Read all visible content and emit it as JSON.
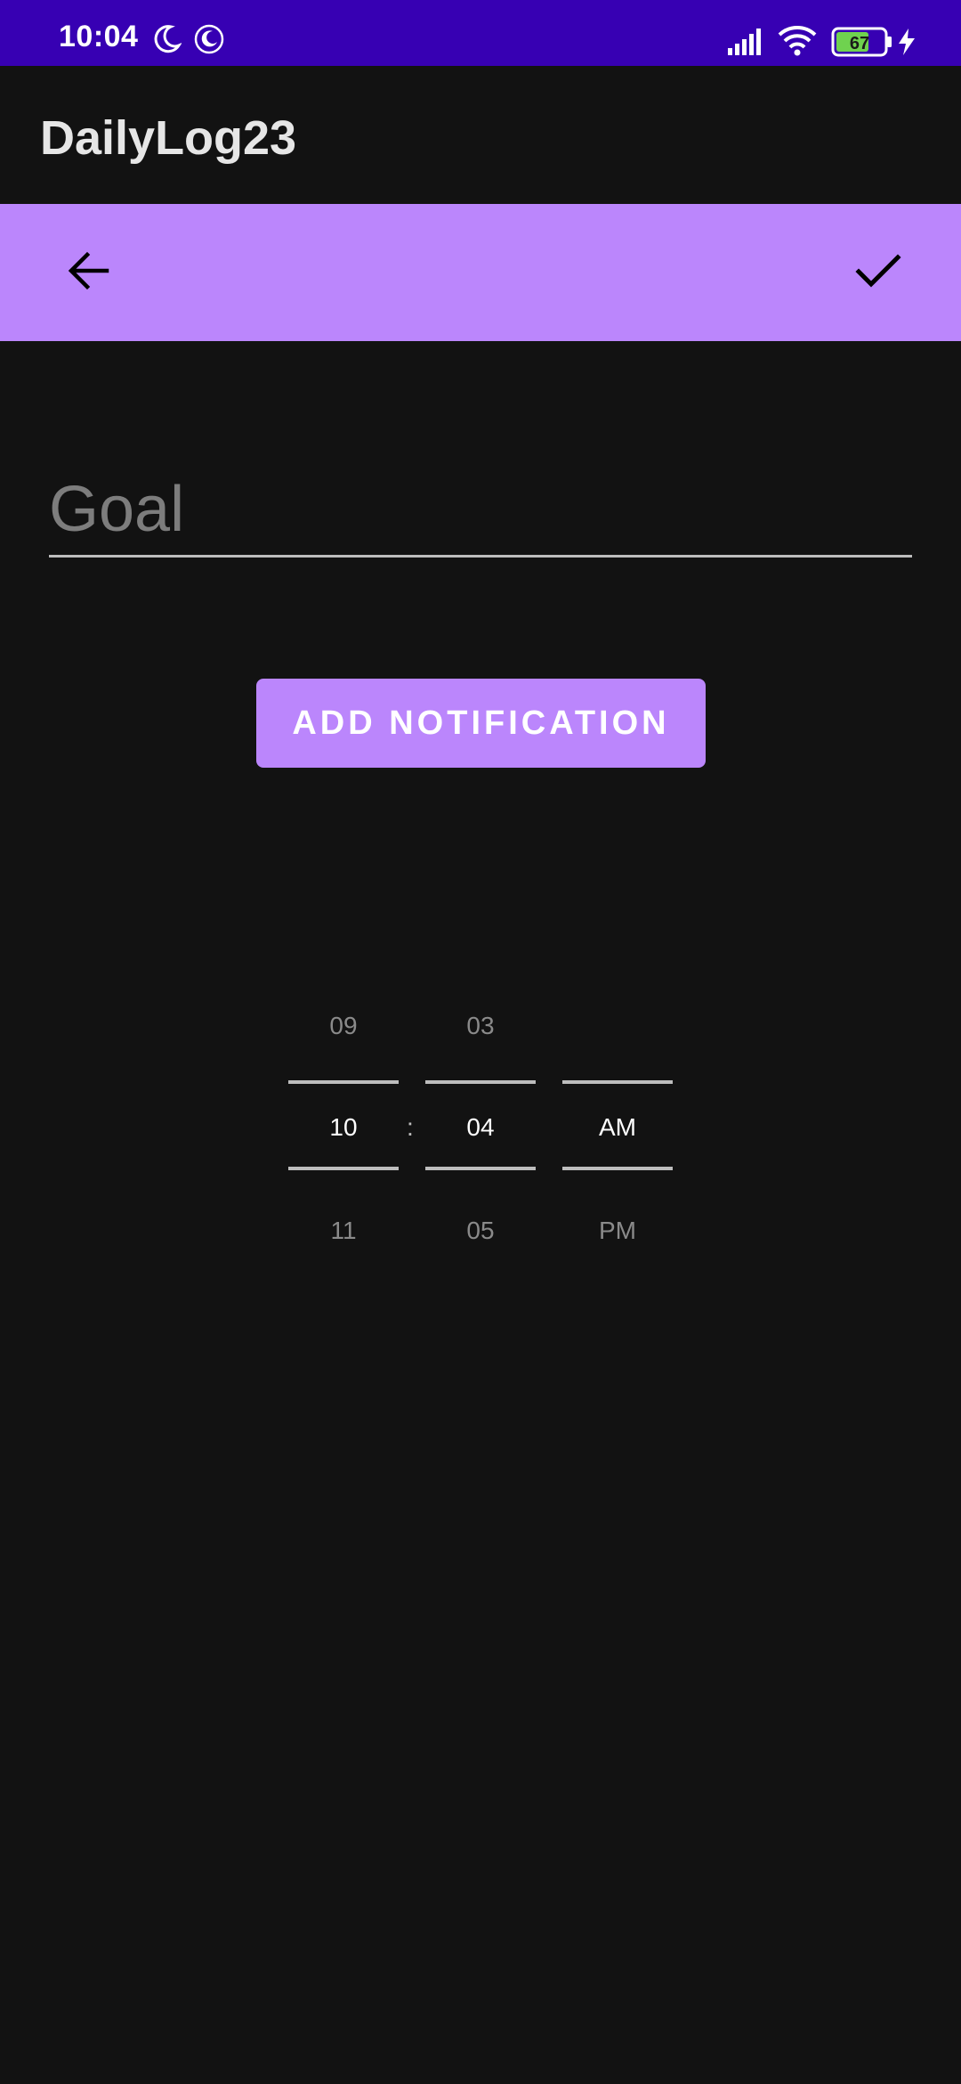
{
  "status_bar": {
    "time": "10:04",
    "battery_level": "67",
    "icons": [
      "moon-icon",
      "dnd-moon-icon",
      "signal-icon",
      "wifi-icon",
      "battery-icon",
      "charging-icon"
    ]
  },
  "app_bar": {
    "title": "DailyLog23"
  },
  "toolbar": {
    "back_icon": "arrow-back-icon",
    "confirm_icon": "check-icon",
    "accent": "#bb86fc"
  },
  "goal": {
    "placeholder": "Goal",
    "value": ""
  },
  "add_button": {
    "label": "ADD NOTIFICATION"
  },
  "time_picker": {
    "separator": ":",
    "hour": {
      "prev": "09",
      "current": "10",
      "next": "11"
    },
    "minute": {
      "prev": "03",
      "current": "04",
      "next": "05"
    },
    "ampm": {
      "prev": "",
      "current": "AM",
      "next": "PM"
    }
  },
  "colors": {
    "status_bar": "#3700b3",
    "background": "#121212",
    "accent": "#bb86fc"
  }
}
